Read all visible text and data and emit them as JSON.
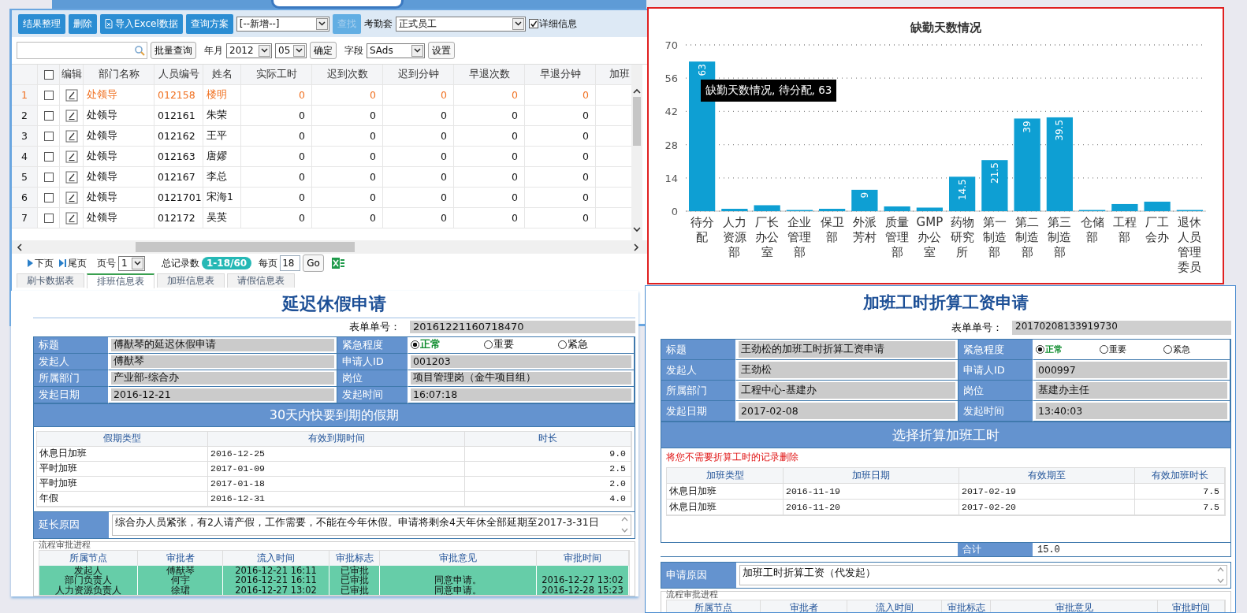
{
  "attendance_grid": {
    "toolbar_buttons": [
      {
        "label": "结果整理",
        "kind": "plain"
      },
      {
        "label": "删除",
        "kind": "plain"
      },
      {
        "label": "导入Excel数据",
        "kind": "import"
      }
    ],
    "scheme_button": "查询方案",
    "scheme_select": "[--新增--]",
    "find_button": {
      "label": "查找",
      "disabled": true
    },
    "set_label": "考勤套",
    "set_select": "正式员工",
    "detail_checkbox": {
      "label": "详细信息",
      "checked": true
    },
    "batch_query_button": "批量查询",
    "year_month_label": "年月",
    "year_select": "2012",
    "month_select": "05",
    "confirm_button": "确定",
    "field_label": "字段",
    "field_select": "SAds",
    "settings_button": "设置",
    "table": {
      "header_checked": false,
      "edit_header": "编辑",
      "columns": [
        "部门名称",
        "人员编号",
        "姓名",
        "实际工时",
        "迟到次数",
        "迟到分钟",
        "早退次数",
        "早退分钟",
        "加班"
      ],
      "rows": [
        {
          "index": "1",
          "checked": false,
          "selected": true,
          "cells": [
            "处领导",
            "012158",
            "楼明",
            "0",
            "0",
            "0",
            "0",
            "0"
          ]
        },
        {
          "index": "2",
          "checked": false,
          "selected": false,
          "cells": [
            "处领导",
            "012161",
            "朱荣",
            "0",
            "0",
            "0",
            "0",
            "0"
          ]
        },
        {
          "index": "3",
          "checked": false,
          "selected": false,
          "cells": [
            "处领导",
            "012162",
            "王平",
            "0",
            "0",
            "0",
            "0",
            "0"
          ]
        },
        {
          "index": "4",
          "checked": false,
          "selected": false,
          "cells": [
            "处领导",
            "012163",
            "唐嫪",
            "0",
            "0",
            "0",
            "0",
            "0"
          ]
        },
        {
          "index": "5",
          "checked": false,
          "selected": false,
          "cells": [
            "处领导",
            "012167",
            "李总",
            "0",
            "0",
            "0",
            "0",
            "0"
          ]
        },
        {
          "index": "6",
          "checked": false,
          "selected": false,
          "cells": [
            "处领导",
            "0121701",
            "宋海1",
            "0",
            "0",
            "0",
            "0",
            "0"
          ]
        },
        {
          "index": "7",
          "checked": false,
          "selected": false,
          "cells": [
            "处领导",
            "012172",
            "吴英",
            "0",
            "0",
            "0",
            "0",
            "0"
          ]
        }
      ]
    },
    "pager": {
      "next": "下页",
      "last": "尾页",
      "page_label": "页号",
      "page_select": "1",
      "total_label": "总记录数",
      "total": "1-18/60",
      "per_page_label": "每页",
      "per_page": "18",
      "go": "Go"
    },
    "tabs": [
      {
        "label": "刷卡数据表",
        "selected": false
      },
      {
        "label": "排班信息表",
        "selected": true
      },
      {
        "label": "加班信息表",
        "selected": false
      },
      {
        "label": "请假信息表",
        "selected": false
      }
    ]
  },
  "absence_chart": {
    "tooltip": "缺勤天数情况, 待分配, 63",
    "chart_data": {
      "type": "bar",
      "title": "缺勤天数情况",
      "categories": [
        "待分配",
        "人力资源部",
        "厂长办公室",
        "企业管理部",
        "保卫部",
        "外派芳村",
        "质量管理部",
        "GMP办公室",
        "药物研究所",
        "第一制造部",
        "第二制造部",
        "第三制造部",
        "仓储部",
        "工程部",
        "厂工会办",
        "退休人员管理委员"
      ],
      "values": [
        63,
        1,
        2.5,
        0.5,
        1,
        9,
        2,
        1.5,
        14.5,
        21.5,
        39,
        39.5,
        0.5,
        3,
        4,
        0.5
      ],
      "ylim": [
        0,
        70
      ],
      "grid": true,
      "yticks": [
        0,
        14,
        28,
        42,
        56,
        70
      ],
      "value_labels": [
        "63",
        null,
        null,
        null,
        null,
        "9",
        null,
        null,
        "14.5",
        "21.5",
        "39",
        "39.5",
        null,
        null,
        null,
        null
      ]
    }
  },
  "forms": [
    {
      "kind": "leave",
      "title": "延迟休假申请",
      "serial_label": "表单单号：",
      "serial": "20161221160718470",
      "fields": [
        [
          {
            "label": "标题",
            "value": "傅猷琴的延迟休假申请"
          },
          {
            "label": "紧急程度",
            "kind": "radio",
            "options": [
              {
                "label": "正常",
                "selected": true
              },
              {
                "label": "重要",
                "selected": false
              },
              {
                "label": "紧急",
                "selected": false
              }
            ]
          }
        ],
        [
          {
            "label": "发起人",
            "value": "傅猷琴"
          },
          {
            "label": "申请人ID",
            "value": "001203"
          }
        ],
        [
          {
            "label": "所属部门",
            "value": "产业部-综合办"
          },
          {
            "label": "岗位",
            "value": "项目管理岗（金牛项目组）"
          }
        ],
        [
          {
            "label": "发起日期",
            "value": "2016-12-21"
          },
          {
            "label": "发起时间",
            "value": "16:07:18"
          }
        ]
      ],
      "section": {
        "heading": "30天内快要到期的假期",
        "columns": [
          "假期类型",
          "有效到期时间",
          "时长"
        ],
        "rows": [
          [
            "休息日加班",
            "2016-12-25",
            "9.0"
          ],
          [
            "平时加班",
            "2017-01-09",
            "2.5"
          ],
          [
            "平时加班",
            "2017-01-18",
            "2.0"
          ],
          [
            "年假",
            "2016-12-31",
            "4.0"
          ]
        ]
      },
      "reason": {
        "label": "延长原因",
        "value": "综合办人员紧张，有2人请产假，工作需要，不能在今年休假。申请将剩余4天年休全部延期至2017-3-31日"
      },
      "approval": {
        "legend": "流程审批进程",
        "columns": [
          "所属节点",
          "审批者",
          "流入时间",
          "审批标志",
          "审批意见",
          "审批时间"
        ],
        "rows": [
          {
            "node": "发起人",
            "approver": "傅猷琴",
            "in_time": "2016-12-21 16:11",
            "flag": "已审批"
          },
          {
            "node": "部门负责人",
            "approver": "何宇",
            "in_time": "2016-12-21 16:11",
            "flag": "已审批",
            "opinion": "同意申请。",
            "time": "2016-12-27 13:02"
          },
          {
            "node": "人力资源负责人",
            "approver": "徐珺",
            "in_time": "2016-12-27 13:02",
            "flag": "已审批",
            "opinion": "同意申请。",
            "time": "2016-12-28 15:23"
          }
        ]
      }
    },
    {
      "kind": "overtime",
      "title": "加班工时折算工资申请",
      "serial_label": "表单单号：",
      "serial": "20170208133919730",
      "fields": [
        [
          {
            "label": "标题",
            "value": "王劲松的加班工时折算工资申请"
          },
          {
            "label": "紧急程度",
            "kind": "radio",
            "options": [
              {
                "label": "正常",
                "selected": true
              },
              {
                "label": "重要",
                "selected": false
              },
              {
                "label": "紧急",
                "selected": false
              }
            ]
          }
        ],
        [
          {
            "label": "发起人",
            "value": "王劲松"
          },
          {
            "label": "申请人ID",
            "value": "000997"
          }
        ],
        [
          {
            "label": "所属部门",
            "value": "工程中心-基建办"
          },
          {
            "label": "岗位",
            "value": "基建办主任"
          }
        ],
        [
          {
            "label": "发起日期",
            "value": "2017-02-08"
          },
          {
            "label": "发起时间",
            "value": "13:40:03"
          }
        ]
      ],
      "section": {
        "heading": "选择折算加班工时",
        "note": "将您不需要折算工时的记录删除",
        "columns": [
          "加班类型",
          "加班日期",
          "有效期至",
          "有效加班时长"
        ],
        "rows": [
          [
            "休息日加班",
            "2016-11-19",
            "2017-02-19",
            "7.5"
          ],
          [
            "休息日加班",
            "2016-11-20",
            "2017-02-20",
            "7.5"
          ]
        ]
      },
      "total": {
        "label": "合计",
        "value": "15.0"
      },
      "reason": {
        "label": "申请原因",
        "value": "加班工时折算工资（代发起）"
      },
      "approval": {
        "legend": "流程审批进程",
        "columns": [
          "所属节点",
          "审批者",
          "流入时间",
          "审批标志",
          "审批意见",
          "审批时间"
        ]
      }
    }
  ]
}
